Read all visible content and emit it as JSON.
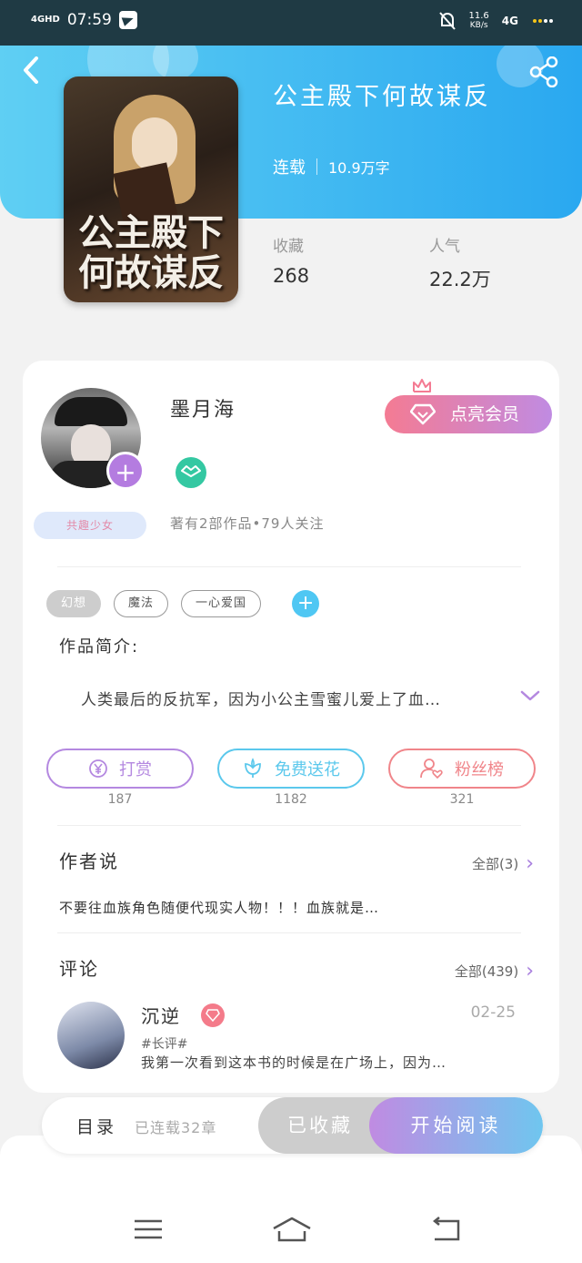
{
  "status_bar": {
    "time": "07:59",
    "network_left": "4GHD",
    "speed_value": "11.6",
    "speed_unit": "KB/s",
    "network_right": "4G"
  },
  "header": {
    "book_title": "公主殿下何故谋反",
    "status": "连载",
    "word_count": "10.9万字",
    "cover_title": "公主殿下何故谋反"
  },
  "stats": [
    {
      "label": "收藏",
      "value": "268"
    },
    {
      "label": "人气",
      "value": "22.2万"
    }
  ],
  "author": {
    "name": "墨月海",
    "tag": "共趣少女",
    "stats": "著有2部作品•79人关注",
    "vip_button": "点亮会员"
  },
  "tags": [
    "幻想",
    "魔法",
    "一心爱国"
  ],
  "synopsis": {
    "label": "作品简介:",
    "text": "人类最后的反抗军，因为小公主雪蜜儿爱上了血…"
  },
  "actions": [
    {
      "label": "打赏",
      "count": "187",
      "color": "#b488e0"
    },
    {
      "label": "免费送花",
      "count": "1182",
      "color": "#5bc8ec"
    },
    {
      "label": "粉丝榜",
      "count": "321",
      "color": "#f0858a"
    }
  ],
  "author_say": {
    "title": "作者说",
    "more": "全部(3)",
    "text": "不要往血族角色随便代现实人物！！！血族就是…"
  },
  "comments": {
    "title": "评论",
    "more": "全部(439)",
    "items": [
      {
        "name": "沉逆",
        "date": "02-25",
        "tag": "#长评#",
        "text": "我第一次看到这本书的时候是在广场上，因为…"
      }
    ]
  },
  "bottom": {
    "toc_label": "目录",
    "chapters": "已连载32章",
    "collected_label": "已收藏",
    "start_label": "开始阅读"
  },
  "colors": {
    "header_start": "#5fcff3",
    "header_end": "#2aa8f0",
    "accent_purple": "#b47ce0",
    "accent_pink": "#f47b93"
  }
}
